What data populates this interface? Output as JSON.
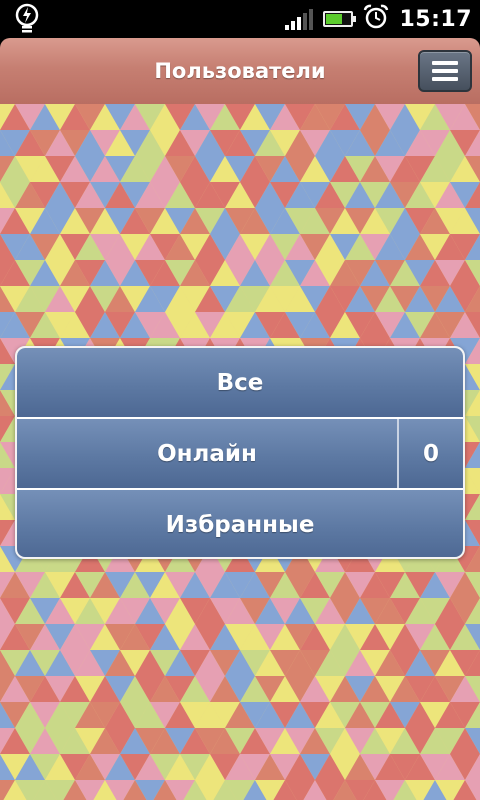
{
  "status_bar": {
    "time": "15:17",
    "notification_icon": "bulb-icon",
    "signal_icon": "signal-icon",
    "battery_icon": "battery-icon",
    "alarm_icon": "alarm-clock-icon",
    "battery_color": "#5ccc2e"
  },
  "header": {
    "title": "Пользователи",
    "menu_icon": "hamburger-menu-icon"
  },
  "menu": {
    "items": [
      {
        "label": "Все"
      },
      {
        "label": "Онлайн",
        "count": "0"
      },
      {
        "label": "Избранные"
      }
    ]
  },
  "colors": {
    "header": "#c67f72",
    "row": "#5d79a3",
    "pattern": [
      "#d96a6a",
      "#e69ab8",
      "#7aa0de",
      "#ede77a",
      "#c5d988",
      "#d77a6a"
    ]
  }
}
